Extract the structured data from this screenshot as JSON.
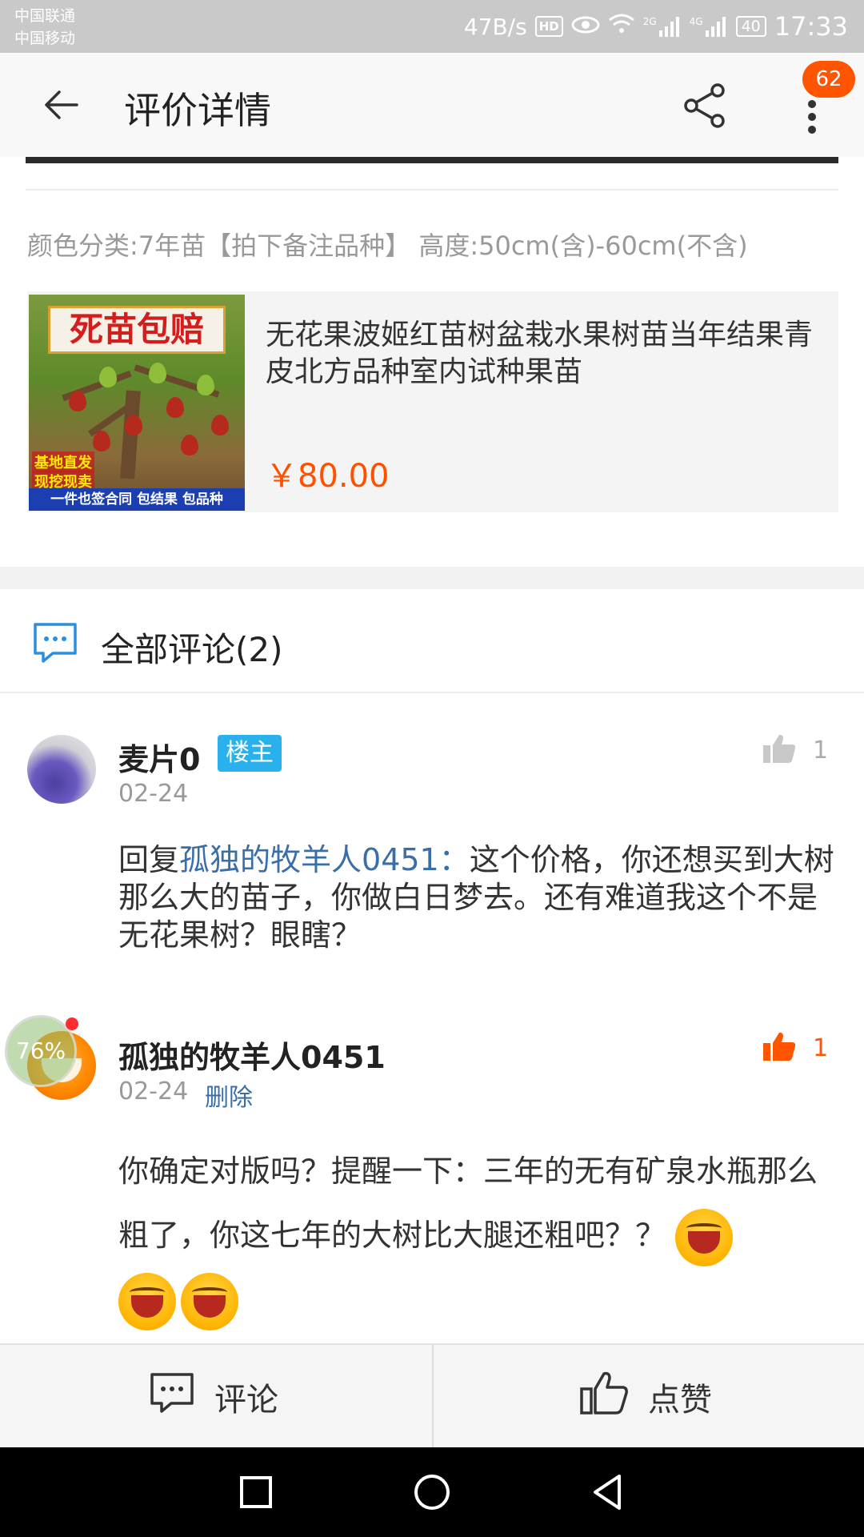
{
  "status_bar": {
    "carrier1": "中国联通",
    "carrier2": "中国移动",
    "speed": "47B/s",
    "hd": "HD",
    "net1": "2G",
    "net2": "4G",
    "battery": "40",
    "time": "17:33"
  },
  "header": {
    "title": "评价详情",
    "badge_count": "62",
    "back_icon": "arrow-left-icon",
    "share_icon": "share-icon",
    "more_icon": "more-vertical-icon"
  },
  "review": {
    "sku": "颜色分类:7年苗【拍下备注品种】 高度:50cm(含)-60cm(不含)"
  },
  "product": {
    "image_banner": "死苗包赔",
    "image_tag1": "基地直发",
    "image_tag2": "现挖现卖",
    "image_footer": "一件也签合同 包结果 包品种",
    "title": "无花果波姬红苗树盆栽水果树苗当年结果青皮北方品种室内试种果苗",
    "price": "￥80.00"
  },
  "comments_section": {
    "title": "全部评论(2)",
    "items": [
      {
        "name": "麦片0",
        "badge": "楼主",
        "date": "02-24",
        "likes": "1",
        "liked": false,
        "reply_prefix": "回复",
        "reply_to": "孤独的牧羊人0451：",
        "text": "这个价格，你还想买到大树那么大的苗子，你做白日梦去。还有难道我这个不是无花果树？眼瞎？"
      },
      {
        "name": "孤独的牧羊人0451",
        "date": "02-24",
        "delete_label": "删除",
        "likes": "1",
        "liked": true,
        "text": "你确定对版吗？提醒一下：三年的无有矿泉水瓶那么粗了，你这七年的大树比大腿还粗吧？？",
        "emoji": "laughing-emoji"
      }
    ]
  },
  "overlay": {
    "progress_label": "76%"
  },
  "actions": {
    "comment_label": "评论",
    "like_label": "点赞"
  },
  "colors": {
    "accent": "#ff5000",
    "badge_blue": "#28b1ec",
    "link_blue": "#3a6ea8",
    "like_active": "#ff5500"
  }
}
